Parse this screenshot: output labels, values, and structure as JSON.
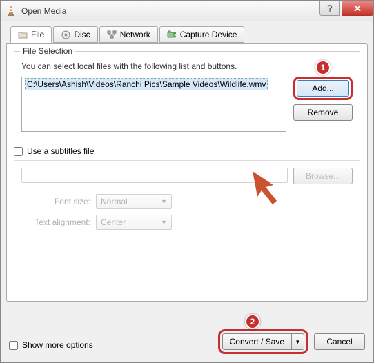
{
  "titlebar": {
    "title": "Open Media"
  },
  "tabs": {
    "file": "File",
    "disc": "Disc",
    "network": "Network",
    "capture": "Capture Device"
  },
  "file_selection": {
    "legend": "File Selection",
    "hint": "You can select local files with the following list and buttons.",
    "items": [
      "C:\\Users\\Ashish\\Videos\\Ranchi Pics\\Sample Videos\\Wildlife.wmv"
    ],
    "add_label": "Add...",
    "remove_label": "Remove"
  },
  "subtitles": {
    "checkbox_label": "Use a subtitles file",
    "browse_label": "Browse...",
    "font_size_label": "Font size:",
    "font_size_value": "Normal",
    "text_align_label": "Text alignment:",
    "text_align_value": "Center"
  },
  "bottom": {
    "show_more": "Show more options",
    "convert": "Convert / Save",
    "cancel": "Cancel"
  },
  "annotations": {
    "badge1": "1",
    "badge2": "2"
  }
}
